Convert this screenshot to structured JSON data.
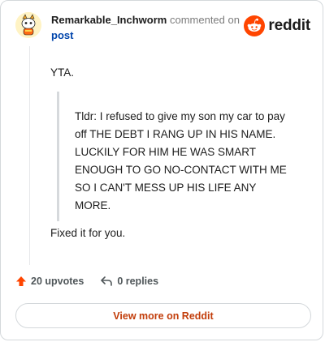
{
  "comment": {
    "username": "Remarkable_Inchworm",
    "commented_on": "commented on",
    "post_link": "post",
    "paragraph_1": "YTA.",
    "quote": "Tldr: I refused to give my son my car to pay off THE DEBT I RANG UP IN HIS NAME. LUCKILY FOR HIM HE WAS SMART ENOUGH TO GO NO-CONTACT WITH ME SO I CAN'T MESS UP HIS LIFE ANY MORE.",
    "paragraph_2": "Fixed it for you."
  },
  "brand": {
    "name": "reddit",
    "color": "#ff4500"
  },
  "actions": {
    "upvotes": "20 upvotes",
    "replies": "0 replies",
    "upvote_icon": "upvote-arrow-icon",
    "reply_icon": "reply-arrow-icon",
    "upvote_color": "#ff4500"
  },
  "footer": {
    "view_more": "View more on Reddit",
    "color": "#c23d0a"
  }
}
